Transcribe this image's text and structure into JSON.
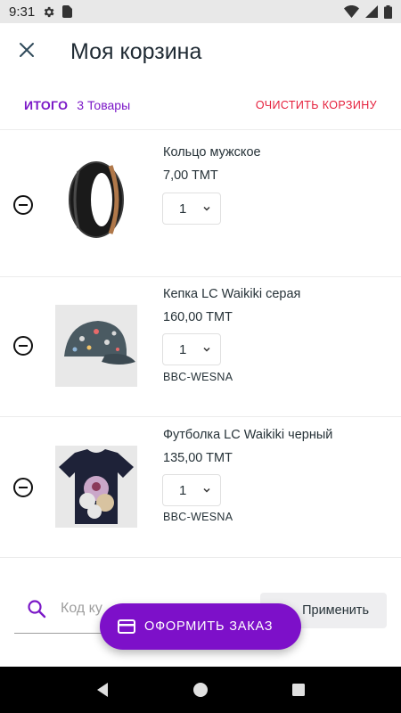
{
  "status_bar": {
    "time": "9:31",
    "icons": [
      "gear-icon",
      "sim-card-icon",
      "wifi-icon",
      "signal-icon",
      "battery-icon"
    ]
  },
  "header": {
    "title": "Моя корзина",
    "close_icon": "close-icon"
  },
  "summary": {
    "total_label": "ИТОГО",
    "items_count": "3 Товары",
    "clear_label": "ОЧИСТИТЬ КОРЗИНУ"
  },
  "items": [
    {
      "name": "Кольцо мужское",
      "price": "7,00 TMT",
      "qty": "1",
      "sku": "",
      "image": "ring-image"
    },
    {
      "name": "Кепка LC Waikiki серая",
      "price": "160,00 TMT",
      "qty": "1",
      "sku": "BBC-WESNA",
      "image": "cap-image"
    },
    {
      "name": "Футболка LC Waikiki черный",
      "price": "135,00 TMT",
      "qty": "1",
      "sku": "BBC-WESNA",
      "image": "tshirt-image"
    }
  ],
  "coupon": {
    "placeholder": "Код ку",
    "apply_label": "Применить"
  },
  "checkout": {
    "label": "ОФОРМИТЬ ЗАКАЗ"
  },
  "colors": {
    "accent": "#7d10c9",
    "danger": "#e51f3b",
    "text": "#263238"
  }
}
